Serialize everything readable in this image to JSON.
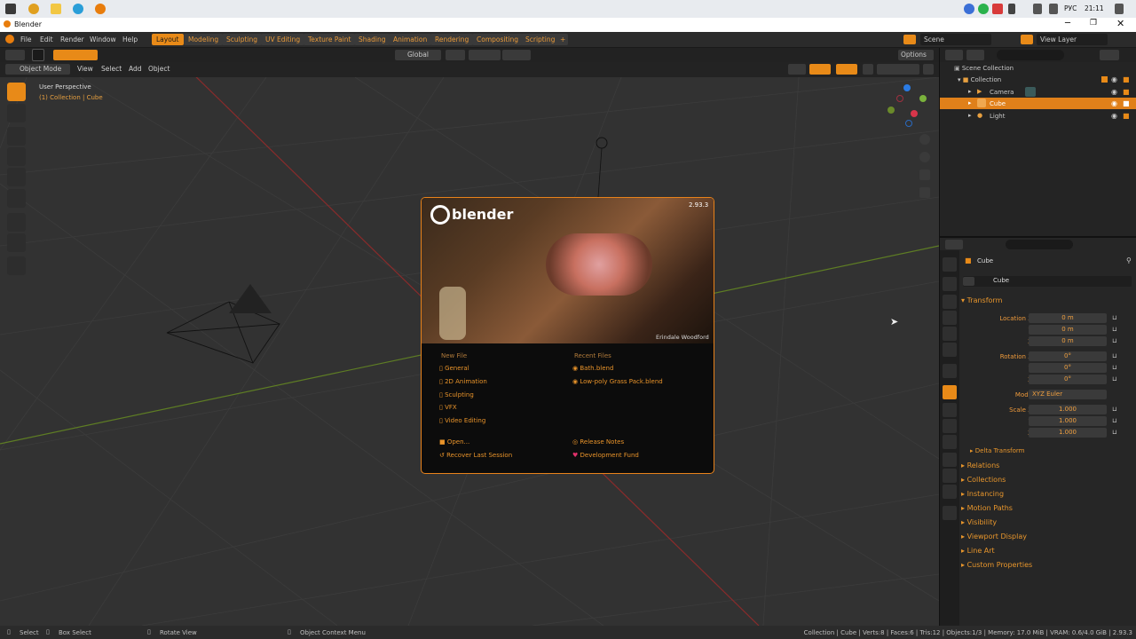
{
  "taskbar": {
    "lang": "РУС",
    "time": "21:11"
  },
  "window": {
    "title": "Blender"
  },
  "menu": {
    "items": [
      "File",
      "Edit",
      "Render",
      "Window",
      "Help"
    ]
  },
  "workspaces": [
    "Layout",
    "Modeling",
    "Sculpting",
    "UV Editing",
    "Texture Paint",
    "Shading",
    "Animation",
    "Rendering",
    "Compositing",
    "Scripting"
  ],
  "scene": {
    "name": "Scene",
    "view_layer": "View Layer"
  },
  "header2": {
    "orientation": "Global",
    "options": "Options"
  },
  "header3": {
    "mode": "Object Mode",
    "view": "View",
    "select": "Select",
    "add": "Add",
    "object": "Object"
  },
  "viewport": {
    "perspective": "User Perspective",
    "collection_info": "(1) Collection | Cube"
  },
  "splash": {
    "brand": "blender",
    "version": "2.93.3",
    "credit": "Erindale Woodford",
    "new_file_title": "New File",
    "recent_title": "Recent Files",
    "new_items": [
      "General",
      "2D Animation",
      "Sculpting",
      "VFX",
      "Video Editing"
    ],
    "recent_items": [
      "Bath.blend",
      "Low-poly Grass Pack.blend"
    ],
    "open": "Open...",
    "recover": "Recover Last Session",
    "release_notes": "Release Notes",
    "dev_fund": "Development Fund"
  },
  "outliner": {
    "scene_collection": "Scene Collection",
    "collection": "Collection",
    "items": [
      "Camera",
      "Cube",
      "Light"
    ]
  },
  "properties": {
    "object_name": "Cube",
    "data_name": "Cube",
    "transform": "Transform",
    "location_label": "Location X",
    "rotation_label": "Rotation X",
    "scale_label": "Scale X",
    "axis_y": "Y",
    "axis_z": "Z",
    "location": [
      "0 m",
      "0 m",
      "0 m"
    ],
    "rotation": [
      "0°",
      "0°",
      "0°"
    ],
    "scale": [
      "1.000",
      "1.000",
      "1.000"
    ],
    "mode_label": "Mode",
    "mode": "XYZ Euler",
    "delta": "Delta Transform",
    "panels": [
      "Relations",
      "Collections",
      "Instancing",
      "Motion Paths",
      "Visibility",
      "Viewport Display",
      "Line Art",
      "Custom Properties"
    ]
  },
  "status": {
    "select": "Select",
    "box_select": "Box Select",
    "rotate": "Rotate View",
    "context": "Object Context Menu",
    "info": "Collection | Cube | Verts:8 | Faces:6 | Tris:12 | Objects:1/3 | Memory: 17.0 MiB | VRAM: 0.6/4.0 GiB | 2.93.3"
  },
  "colors": {
    "accent": "#e88a18",
    "viewport": "#323232",
    "panel": "#262626"
  }
}
